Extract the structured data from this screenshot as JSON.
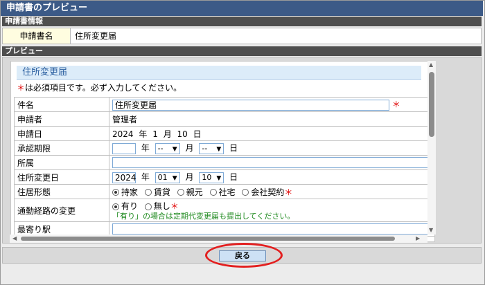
{
  "window": {
    "title": "申請書のプレビュー"
  },
  "info_section": {
    "header": "申請書情報",
    "name_label": "申請書名",
    "name_value": "住所変更届"
  },
  "preview_section": {
    "header": "プレビュー",
    "form_title": "住所変更届",
    "required_mark": "＊",
    "required_note": "は必須項目です。必ず入力してください。",
    "rows": {
      "subject": {
        "label": "件名",
        "value": "住所変更届",
        "required": "＊"
      },
      "applicant": {
        "label": "申請者",
        "value": "管理者"
      },
      "apply_date": {
        "label": "申請日",
        "year": "2024",
        "year_unit": "年",
        "month": "1",
        "month_unit": "月",
        "day": "10",
        "day_unit": "日"
      },
      "approval_deadline": {
        "label": "承認期限",
        "year_value": "",
        "year_unit": "年",
        "month_value": "--",
        "month_unit": "月",
        "day_value": "--",
        "day_unit": "日"
      },
      "department": {
        "label": "所属",
        "value": ""
      },
      "address_change_date": {
        "label": "住所変更日",
        "year_value": "2024",
        "year_unit": "年",
        "month_value": "01",
        "month_unit": "月",
        "day_value": "10",
        "day_unit": "日"
      },
      "housing_type": {
        "label": "住居形態",
        "options": [
          "持家",
          "賃貸",
          "親元",
          "社宅",
          "会社契約"
        ],
        "selected": "持家",
        "required": "＊"
      },
      "commute_change": {
        "label": "通勤経路の変更",
        "options": [
          "有り",
          "無し"
        ],
        "selected": "有り",
        "required": "＊",
        "note": "「有り」の場合は定期代変更届も提出してください。"
      },
      "nearest_station": {
        "label": "最寄り駅",
        "value": ""
      }
    }
  },
  "footer": {
    "back_button": "戻る"
  },
  "colors": {
    "titlebar": "#3c5a87",
    "highlight": "#e31f1f",
    "form_title_bg": "#dcecf9"
  }
}
